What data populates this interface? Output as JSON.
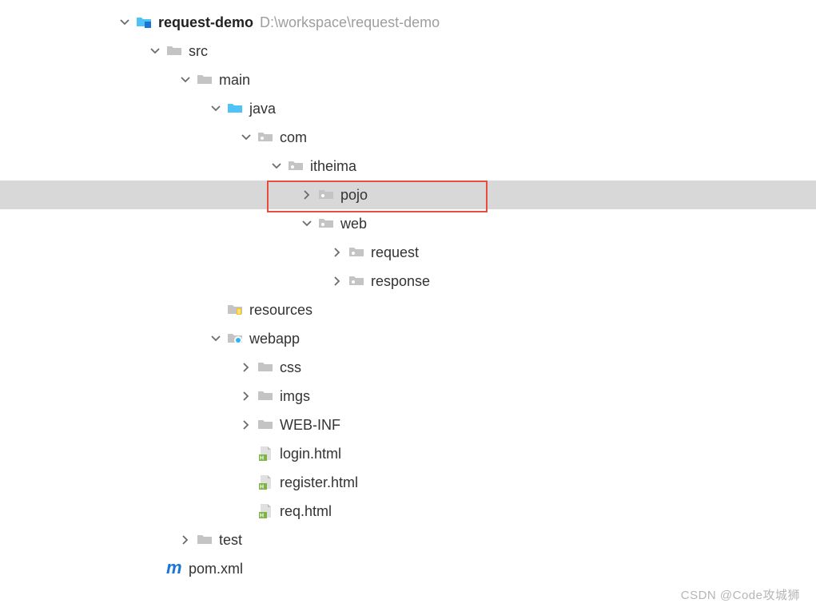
{
  "root": {
    "name": "request-demo",
    "path": "D:\\workspace\\request-demo"
  },
  "nodes": {
    "src": "src",
    "main": "main",
    "java": "java",
    "com": "com",
    "itheima": "itheima",
    "pojo": "pojo",
    "web": "web",
    "request": "request",
    "response": "response",
    "resources": "resources",
    "webapp": "webapp",
    "css": "css",
    "imgs": "imgs",
    "webinf": "WEB-INF",
    "login": "login.html",
    "register": "register.html",
    "req": "req.html",
    "test": "test",
    "pom": "pom.xml"
  },
  "watermark": "CSDN @Code攻城狮"
}
